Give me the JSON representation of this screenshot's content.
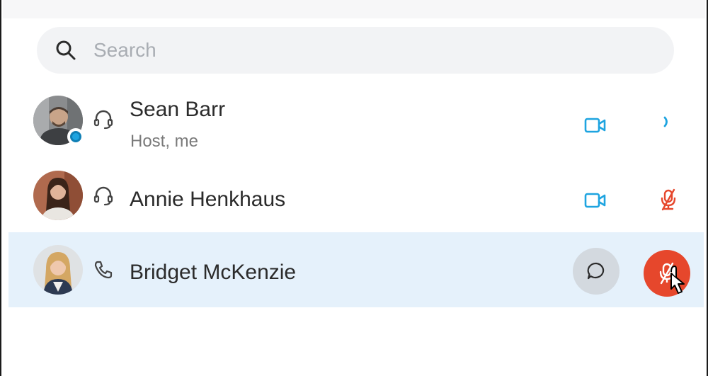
{
  "search": {
    "placeholder": "Search",
    "icon": "search-icon"
  },
  "participants": [
    {
      "name": "Sean Barr",
      "role": "Host, me",
      "status_icon": "headset-icon",
      "presence_badge": true,
      "video_icon": "video-camera-icon",
      "audio_icon": "speaker-icon",
      "selected": false
    },
    {
      "name": "Annie Henkhaus",
      "role": "",
      "status_icon": "headset-icon",
      "video_icon": "video-camera-icon",
      "audio_icon": "microphone-muted-icon",
      "selected": false
    },
    {
      "name": "Bridget McKenzie",
      "role": "",
      "status_icon": "phone-icon",
      "chat_button_icon": "chat-bubble-icon",
      "mute_button_icon": "microphone-muted-icon",
      "selected": true
    }
  ],
  "colors": {
    "accent_blue": "#1ea4e0",
    "muted_red": "#e6472c",
    "selected_row_bg": "#e5f1fb",
    "search_bg": "#f2f3f5",
    "chat_button_bg": "#d3d9df"
  }
}
